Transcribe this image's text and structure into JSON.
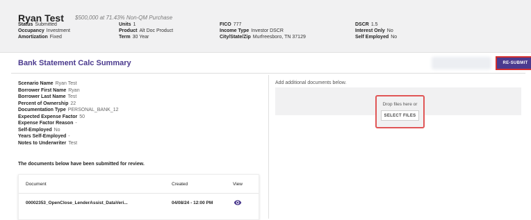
{
  "header": {
    "borrower_name": "Ryan Test",
    "loan_description": "$500,000 at 71.43% Non-QM Purchase",
    "col1": [
      {
        "label": "Status",
        "value": "Submitted"
      },
      {
        "label": "Occupancy",
        "value": "Investment"
      },
      {
        "label": "Amortization",
        "value": "Fixed"
      }
    ],
    "col2": [
      {
        "label": "Units",
        "value": "1"
      },
      {
        "label": "Product",
        "value": "Alt Doc Product"
      },
      {
        "label": "Term",
        "value": "30 Year"
      }
    ],
    "col3": [
      {
        "label": "FICO",
        "value": "777"
      },
      {
        "label": "Income Type",
        "value": "Investor DSCR"
      },
      {
        "label": "City/State/Zip",
        "value": "Murfreesboro, TN 37129"
      }
    ],
    "col4": [
      {
        "label": "DSCR",
        "value": "1.5"
      },
      {
        "label": "Interest Only",
        "value": "No"
      },
      {
        "label": "Self Employed",
        "value": "No"
      }
    ]
  },
  "section": {
    "title": "Bank Statement Calc Summary",
    "resubmit_label": "RE-SUBMIT"
  },
  "details": [
    {
      "label": "Scenario Name",
      "value": "Ryan Test"
    },
    {
      "label": "Borrower First Name",
      "value": "Ryan"
    },
    {
      "label": "Borrower Last Name",
      "value": "Test"
    },
    {
      "label": "Percent of Ownership",
      "value": "22"
    },
    {
      "label": "Documentation Type",
      "value": "PERSONAL_BANK_12"
    },
    {
      "label": "Expected Expense Factor",
      "value": "50"
    },
    {
      "label": "Expense Factor Reason",
      "value": "-"
    },
    {
      "label": "Self-Employed",
      "value": "No"
    },
    {
      "label": "Years Self-Employed",
      "value": "-"
    },
    {
      "label": "Notes to Underwriter",
      "value": "Test"
    }
  ],
  "documents": {
    "message": "The documents below have been submitted for review.",
    "columns": {
      "document": "Document",
      "created": "Created",
      "view": "View"
    },
    "rows": [
      {
        "document": "00002353_OpenClose_LenderAssist_DataVeri...",
        "created": "04/08/24 - 12:00 PM",
        "view_icon": "eye-icon"
      }
    ]
  },
  "upload": {
    "instruction": "Add additional documents below.",
    "drop_text": "Drop files here or",
    "select_label": "SELECT FILES"
  },
  "colors": {
    "accent": "#4b3a8e",
    "highlight": "#d32f2f",
    "header_bg": "#f1f1f2"
  }
}
